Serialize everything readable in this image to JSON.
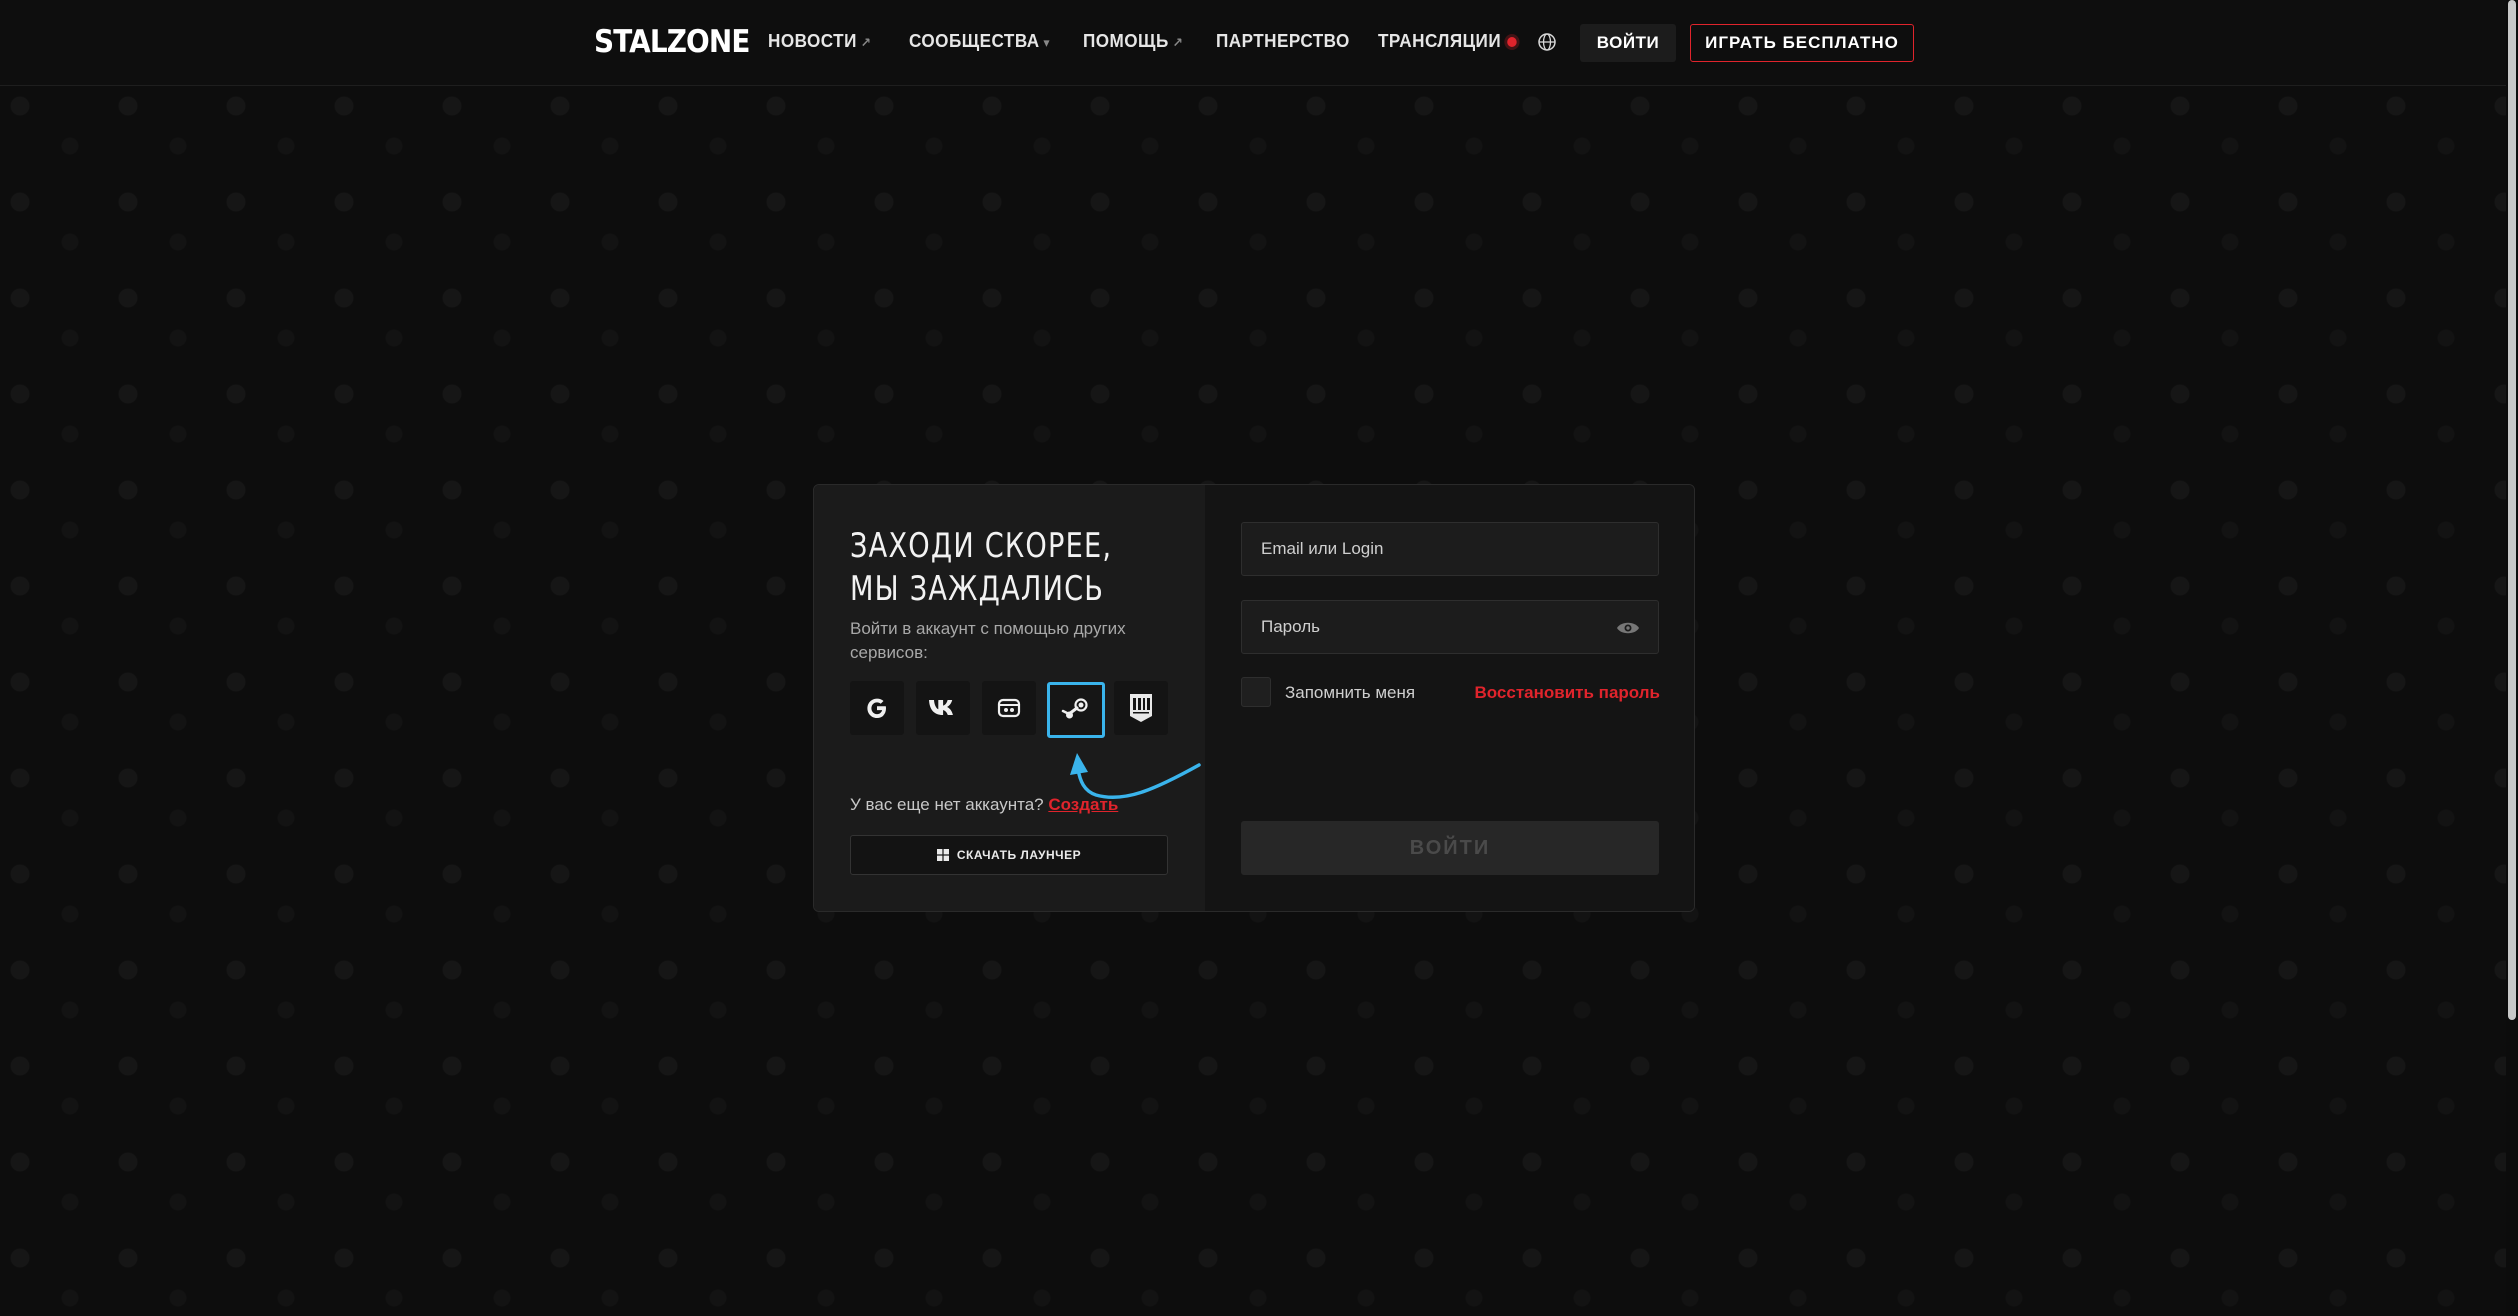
{
  "header": {
    "logo": "STALZONE",
    "nav": [
      {
        "label": "НОВОСТИ",
        "arrow": "↗"
      },
      {
        "label": "СООБЩЕСТВА",
        "arrow": "▾"
      },
      {
        "label": "ПОМОЩЬ",
        "arrow": "↗"
      },
      {
        "label": "ПАРТНЕРСТВО",
        "arrow": ""
      },
      {
        "label": "ТРАНСЛЯЦИИ",
        "arrow": ""
      }
    ],
    "login_label": "ВОЙТИ",
    "play_label": "ИГРАТЬ БЕСПЛАТНО"
  },
  "login": {
    "headline_line1": "ЗАХОДИ СКОРЕЕ,",
    "headline_line2": "МЫ ЗАЖДАЛИСЬ",
    "subtext": "Войти в аккаунт с помощью других сервисов:",
    "socials": [
      "google-icon",
      "vk-icon",
      "mailru-icon",
      "steam-icon",
      "epic-games-icon"
    ],
    "no_account_text": "У вас еще нет аккаунта?",
    "create_link": "Создать",
    "launcher_label": "СКАЧАТЬ ЛАУНЧЕР",
    "email_placeholder": "Email или Login",
    "password_placeholder": "Пароль",
    "remember_label": "Запомнить меня",
    "restore_label": "Восстановить пароль",
    "submit_label": "ВОЙТИ"
  },
  "colors": {
    "accent_red": "#e0242c",
    "highlight_blue": "#3ab4ec"
  }
}
